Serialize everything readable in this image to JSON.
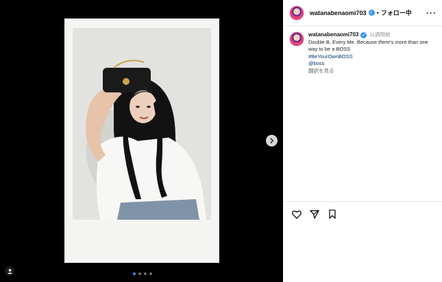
{
  "post": {
    "username": "watanabenaomi703",
    "separator": "•",
    "follow_label": "フォロー中",
    "more": "···",
    "time": "11週間前",
    "caption": "Double B, Every Me. Because there's more than one way to be a BOSS",
    "hashtag": "#BeYourOwnBOSS",
    "mention": "@boss",
    "translate_label": "翻訳を見る",
    "carousel": {
      "count": 4,
      "active_index": 0
    }
  },
  "icons": [
    "verified-badge-icon",
    "more-options-icon",
    "chevron-right-icon",
    "user-tag-icon",
    "heart-icon",
    "share-icon",
    "bookmark-icon"
  ],
  "colors": {
    "accent": "#2f8bff",
    "link": "#00376b",
    "verified": "#3897f0"
  }
}
